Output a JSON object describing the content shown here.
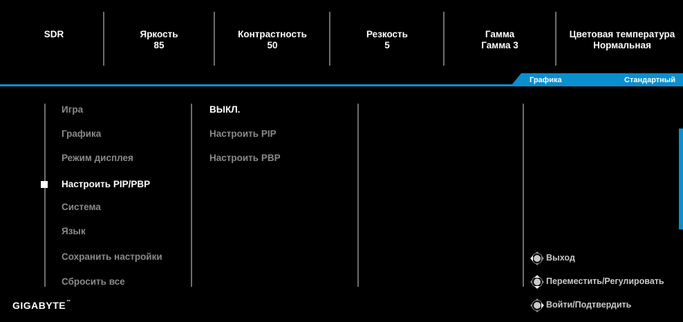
{
  "status_bar": [
    {
      "label": "SDR",
      "value": ""
    },
    {
      "label": "Яркость",
      "value": "85"
    },
    {
      "label": "Контрастность",
      "value": "50"
    },
    {
      "label": "Резкость",
      "value": "5"
    },
    {
      "label": "Гамма",
      "value": "Гамма 3"
    },
    {
      "label": "Цветовая температура",
      "value": "Нормальная"
    }
  ],
  "tab": {
    "category": "Графика",
    "mode": "Стандартный"
  },
  "menu": [
    {
      "label": "Игра"
    },
    {
      "label": "Графика"
    },
    {
      "label": "Режим дисплея"
    },
    {
      "label": "Настроить PIP/PBP",
      "selected": true
    },
    {
      "label": "Система"
    },
    {
      "label": "Язык"
    },
    {
      "label": "Сохранить настройки"
    },
    {
      "label": "Сбросить все"
    }
  ],
  "submenu": [
    {
      "label": "ВЫКЛ.",
      "selected": true
    },
    {
      "label": "Настроить PIP"
    },
    {
      "label": "Настроить PBP"
    }
  ],
  "hints": [
    {
      "label": "Выход",
      "icon": "joystick-left-icon"
    },
    {
      "label": "Переместить/Регулировать",
      "icon": "joystick-updown-icon"
    },
    {
      "label": "Войти/Подтвердить",
      "icon": "joystick-right-icon"
    }
  ],
  "brand": {
    "logo": "GIGABYTE",
    "tm": "™"
  },
  "colors": {
    "accent": "#0a8fcf",
    "background": "#000000",
    "inactive_text": "#8a8a8a"
  }
}
